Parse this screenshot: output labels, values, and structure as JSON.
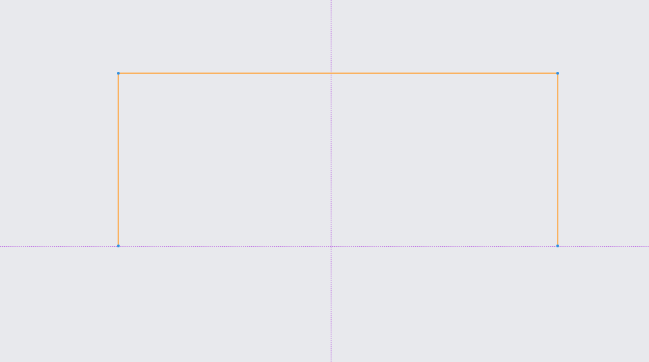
{
  "colors": {
    "background": "#e8e9ed",
    "axis": "#b04be0",
    "sketch_line": "#ffa033",
    "vertex": "#2f8fe0"
  },
  "sketch": {
    "shape": "open-rectangle",
    "segments": [
      "left-edge",
      "top-edge",
      "right-edge"
    ],
    "vertex_count": 4
  },
  "axes": {
    "vertical": "dotted",
    "horizontal": "dotted"
  }
}
